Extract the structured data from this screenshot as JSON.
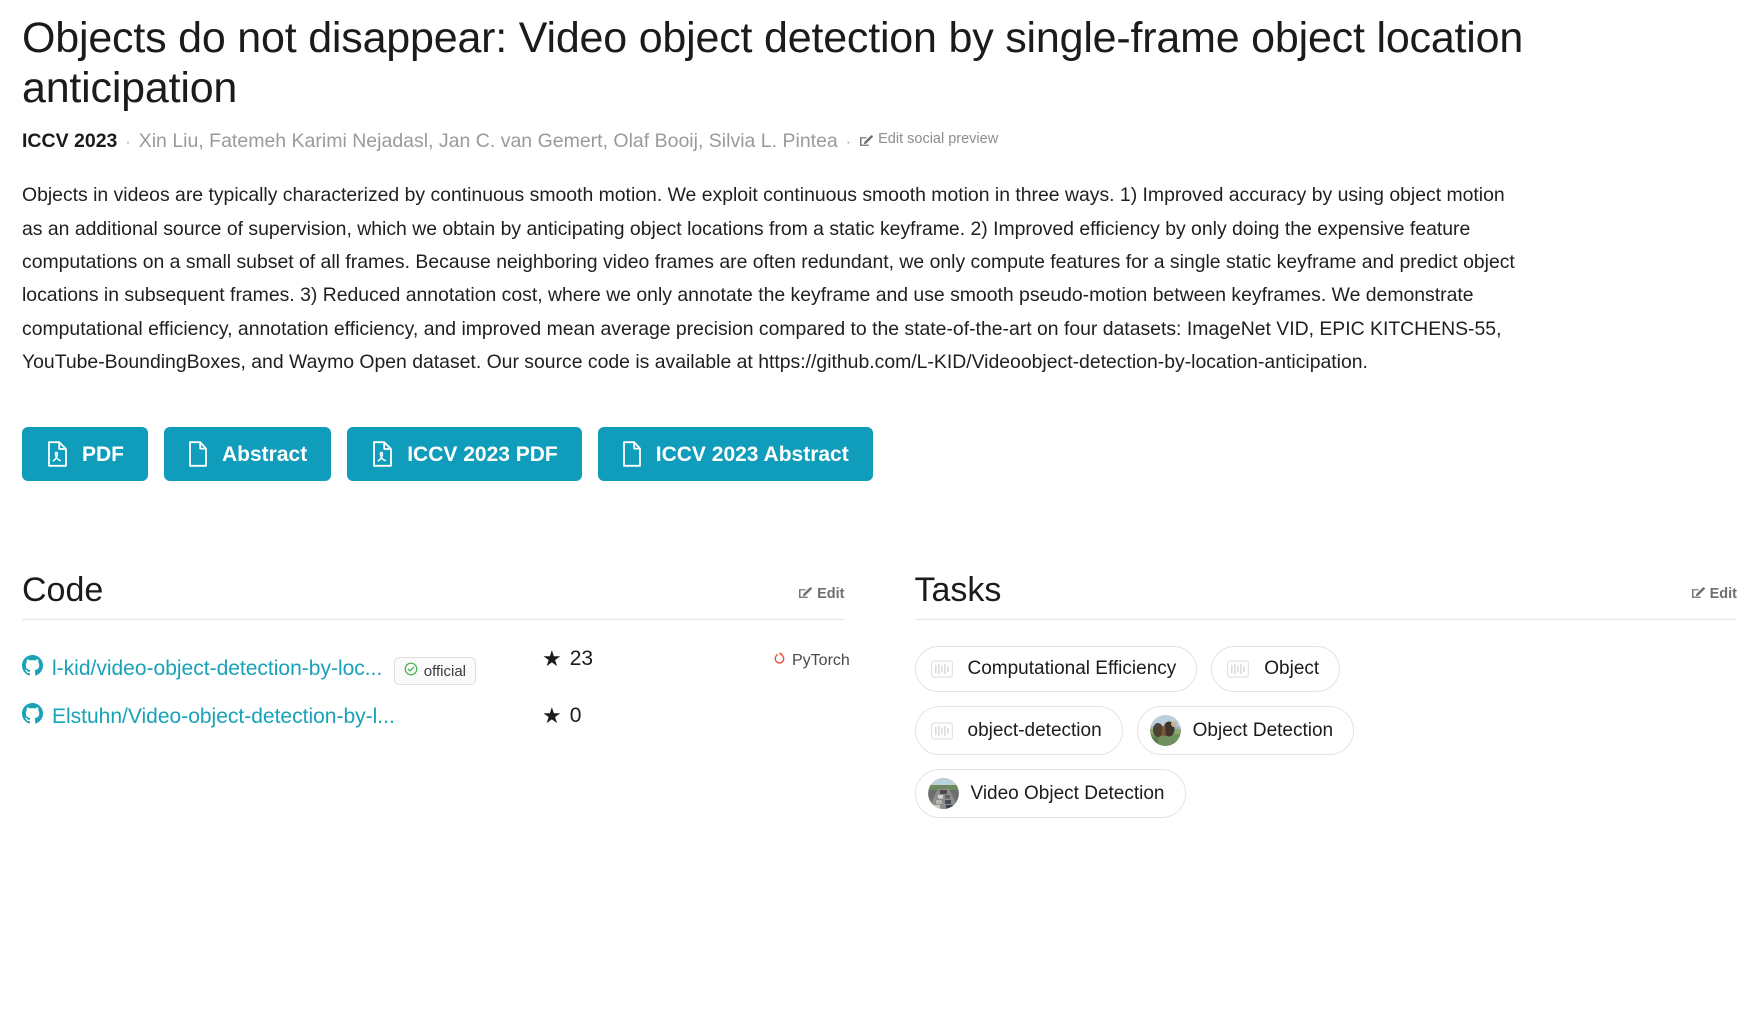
{
  "paper": {
    "title": "Objects do not disappear: Video object detection by single-frame object location anticipation",
    "venue": "ICCV 2023",
    "separator": "·",
    "authors": "Xin Liu, Fatemeh Karimi Nejadasl, Jan C. van Gemert, Olaf Booij, Silvia L. Pintea",
    "edit_social_preview": "Edit social preview",
    "abstract": "Objects in videos are typically characterized by continuous smooth motion. We exploit continuous smooth motion in three ways. 1) Improved accuracy by using object motion as an additional source of supervision, which we obtain by anticipating object locations from a static keyframe. 2) Improved efficiency by only doing the expensive feature computations on a small subset of all frames. Because neighboring video frames are often redundant, we only compute features for a single static keyframe and predict object locations in subsequent frames. 3) Reduced annotation cost, where we only annotate the keyframe and use smooth pseudo-motion between keyframes. We demonstrate computational efficiency, annotation efficiency, and improved mean average precision compared to the state-of-the-art on four datasets: ImageNet VID, EPIC KITCHENS-55, YouTube-BoundingBoxes, and Waymo Open dataset. Our source code is available at https://github.com/L-KID/Videoobject-detection-by-location-anticipation."
  },
  "action_buttons": [
    {
      "label": "PDF",
      "icon": "pdf-file-icon"
    },
    {
      "label": "Abstract",
      "icon": "file-icon"
    },
    {
      "label": "ICCV 2023 PDF",
      "icon": "pdf-file-icon"
    },
    {
      "label": "ICCV 2023 Abstract",
      "icon": "file-icon"
    }
  ],
  "code_section": {
    "title": "Code",
    "edit_label": "Edit",
    "repos": [
      {
        "name": "l-kid/video-object-detection-by-loc...",
        "stars": "23",
        "badge": "official",
        "framework": "PyTorch"
      },
      {
        "name": "Elstuhn/Video-object-detection-by-l...",
        "stars": "0",
        "badge": "",
        "framework": ""
      }
    ]
  },
  "tasks_section": {
    "title": "Tasks",
    "edit_label": "Edit",
    "chips": [
      {
        "label": "Computational Efficiency",
        "thumb": false
      },
      {
        "label": "Object",
        "thumb": false
      },
      {
        "label": "object-detection",
        "thumb": false
      },
      {
        "label": "Object Detection",
        "thumb": true
      },
      {
        "label": "Video Object Detection",
        "thumb": true
      }
    ]
  },
  "colors": {
    "accent": "#0f9dbb",
    "link": "#17a2b8",
    "pytorch": "#ee4c2c",
    "official_check": "#3fae49",
    "muted": "#9a9a9a"
  }
}
